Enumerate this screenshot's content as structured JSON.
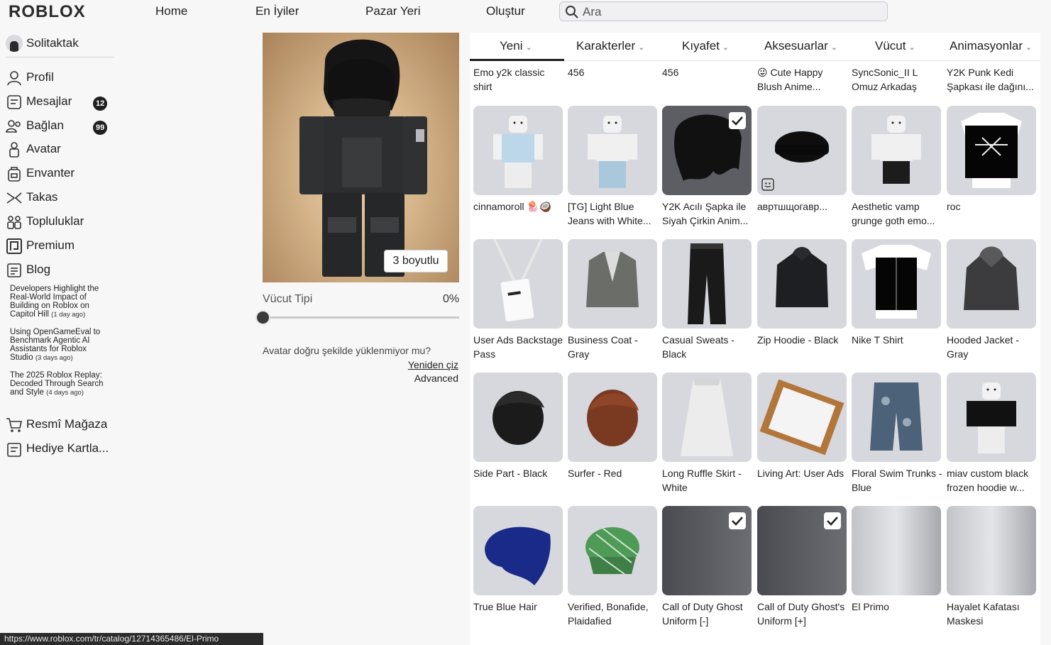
{
  "header": {
    "logo": "ROBLOX",
    "nav": [
      "Home",
      "En İyiler",
      "Pazar Yeri",
      "Oluştur"
    ],
    "search_placeholder": "Ara"
  },
  "sidebar": {
    "username": "Solitaktak",
    "items": [
      {
        "label": "Profil",
        "icon": "user-icon"
      },
      {
        "label": "Mesajlar",
        "icon": "message-icon",
        "badge": "12"
      },
      {
        "label": "Bağlan",
        "icon": "friends-icon",
        "badge": "99"
      },
      {
        "label": "Avatar",
        "icon": "avatar-icon"
      },
      {
        "label": "Envanter",
        "icon": "inventory-icon"
      },
      {
        "label": "Takas",
        "icon": "trade-icon"
      },
      {
        "label": "Topluluklar",
        "icon": "groups-icon"
      },
      {
        "label": "Premium",
        "icon": "premium-icon"
      },
      {
        "label": "Blog",
        "icon": "blog-icon"
      }
    ],
    "blog_posts": [
      {
        "title": "Developers Highlight the Real-World Impact of Building on Roblox on Capitol Hill",
        "ago": "(1 day ago)"
      },
      {
        "title": "Using OpenGameEval to Benchmark Agentic AI Assistants for Roblox Studio",
        "ago": "(3 days ago)"
      },
      {
        "title": "The 2025 Roblox Replay: Decoded Through Search and Style",
        "ago": "(4 days ago)"
      }
    ],
    "bottom_items": [
      {
        "label": "Resmî Mağaza",
        "icon": "store-icon"
      },
      {
        "label": "Hediye Kartla...",
        "icon": "gift-card-icon"
      }
    ]
  },
  "avatar_panel": {
    "view_3d_label": "3 boyutlu",
    "body_type_label": "Vücut Tipi",
    "body_type_value": "0%",
    "hint": "Avatar doğru şekilde yüklenmiyor mu?",
    "redraw": "Yeniden çiz",
    "advanced": "Advanced"
  },
  "tabs": [
    "Yeni",
    "Karakterler",
    "Kıyafet",
    "Aksesuarlar",
    "Vücut",
    "Animasyonlar"
  ],
  "top_row_names": [
    "Emo y2k classic shirt",
    "456",
    "456",
    "😜 Cute Happy Blush Anime...",
    "SyncSonic_II L Omuz Arkadaş",
    "Y2K Punk Kedi Şapkası ile dağını..."
  ],
  "items": [
    {
      "name": "cinnamoroll 🪼🥥",
      "kind": "shirt-blue",
      "selected": false
    },
    {
      "name": "[TG] Light Blue Jeans with White...",
      "kind": "jeans",
      "selected": false
    },
    {
      "name": "Y2K Acılı Şapka ile Siyah Çirkin Anim...",
      "kind": "hair-black",
      "selected": true
    },
    {
      "name": "авртшщогавр...",
      "kind": "beanie",
      "selected": false,
      "emote": true
    },
    {
      "name": "Aesthetic vamp grunge goth emo...",
      "kind": "goth",
      "selected": false
    },
    {
      "name": "roc",
      "kind": "tshirt-band",
      "selected": false
    },
    {
      "name": "User Ads Backstage Pass",
      "kind": "pass",
      "selected": false
    },
    {
      "name": "Business Coat - Gray",
      "kind": "coat-gray",
      "selected": false
    },
    {
      "name": "Casual Sweats - Black",
      "kind": "sweats",
      "selected": false
    },
    {
      "name": "Zip Hoodie - Black",
      "kind": "hoodie-black",
      "selected": false
    },
    {
      "name": "Nike T Shirt",
      "kind": "tshirt-nike",
      "selected": false
    },
    {
      "name": "Hooded Jacket - Gray",
      "kind": "jacket-gray",
      "selected": false
    },
    {
      "name": "Side Part - Black",
      "kind": "hair-side",
      "selected": false
    },
    {
      "name": "Surfer - Red",
      "kind": "hair-red",
      "selected": false
    },
    {
      "name": "Long Ruffle Skirt - White",
      "kind": "skirt",
      "selected": false
    },
    {
      "name": "Living Art: User Ads",
      "kind": "frame",
      "selected": false
    },
    {
      "name": "Floral Swim Trunks - Blue",
      "kind": "trunks",
      "selected": false
    },
    {
      "name": "miav custom black frozen hoodie w...",
      "kind": "hoodie-custom",
      "selected": false
    },
    {
      "name": "True Blue Hair",
      "kind": "hair-blue",
      "selected": false
    },
    {
      "name": "Verified, Bonafide, Plaidafied",
      "kind": "cap-green",
      "selected": false
    },
    {
      "name": "Call of Duty Ghost Uniform [-]",
      "kind": "dark",
      "selected": true
    },
    {
      "name": "Call of Duty Ghost's Uniform [+]",
      "kind": "dark",
      "selected": true
    },
    {
      "name": "El Primo",
      "kind": "grey",
      "selected": false
    },
    {
      "name": "Hayalet Kafatası Maskesi",
      "kind": "grey",
      "selected": false
    }
  ],
  "status_url": "https://www.roblox.com/tr/catalog/12714365486/El-Primo"
}
